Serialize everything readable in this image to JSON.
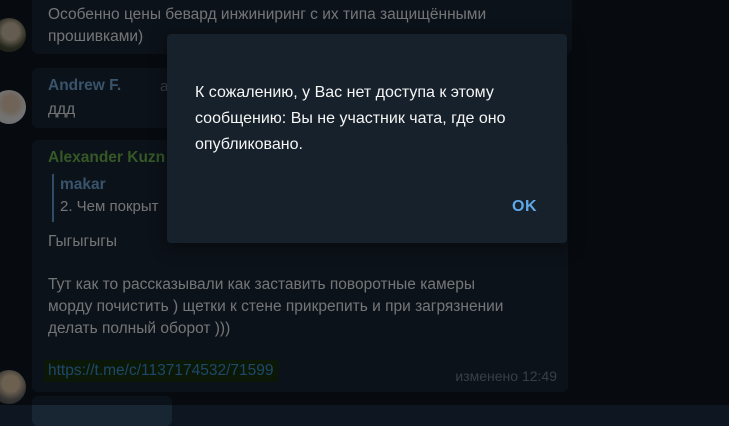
{
  "messages": {
    "first": {
      "text_line1": "Особенно цены бевард инжиниринг с их типа защищёнными",
      "text_line2": "прошивками)"
    },
    "second": {
      "author": "Andrew F.",
      "date_fragment": "a",
      "text": "ддд"
    },
    "third": {
      "author": "Alexander Kuzn",
      "quote_author": "makar",
      "quote_text": "2. Чем покрыт",
      "line1": "Гыгыгыгы",
      "line2": "Тут как то рассказывали как заставить поворотные камеры",
      "line3": "морду почистить ) щетки к стене прикрепить и при загрязнении",
      "line4": "делать полный оборот )))",
      "link": "https://t.me/c/1137174532/71599",
      "edited": "изменено 12:49"
    }
  },
  "dialog": {
    "message_line1": "К сожалению, у Вас нет доступа к этому",
    "message_line2": "сообщению: Вы не участник чата, где оно",
    "message_line3": "опубликовано.",
    "ok_label": "OK"
  }
}
